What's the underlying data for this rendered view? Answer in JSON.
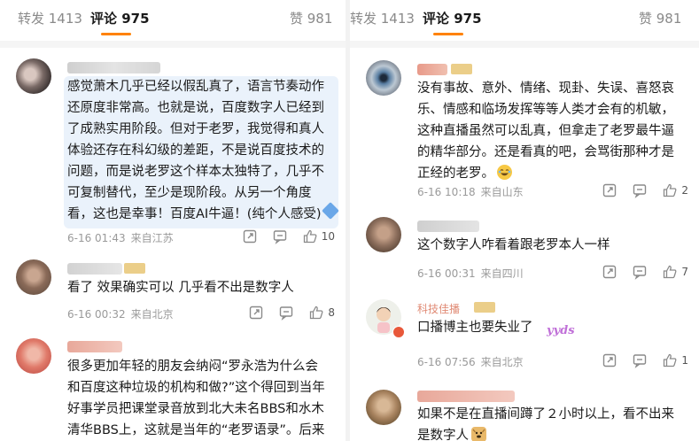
{
  "left": {
    "tabs": [
      {
        "label": "转发 1413"
      },
      {
        "label": "评论 975"
      },
      {
        "label": "赞 981"
      }
    ],
    "comments": [
      {
        "lines": [
          "感觉萧木几乎已经以假乱真了，语言节奏动作",
          "还原度非常高。也就是说，百度数字人已经到",
          "了成熟实用阶段。但对于老罗，我觉得和真人",
          "体验还存在科幻级的差距，不是说百度技术的",
          "问题，而是说老罗这个样本太独特了，几乎不",
          "可复制替代，至少是现阶段。从另一个角度",
          "看，这也是幸事！百度AI牛逼！(纯个人感受)"
        ],
        "date": "6-16 01:43",
        "source": "来自江苏",
        "likes": "10"
      },
      {
        "lines": [
          "看了 效果确实可以 几乎看不出是数字人"
        ],
        "date": "6-16 00:32",
        "source": "来自北京",
        "likes": "8"
      },
      {
        "lines": [
          "很多更加年轻的朋友会纳闷“罗永浩为什么会",
          "和百度这种垃圾的机构和做?”这个得回到当年",
          "好事学员把课堂录音放到北大未名BBS和水木",
          "清华BBS上，这就是当年的“老罗语录”。后来"
        ]
      }
    ]
  },
  "right": {
    "tabs": [
      {
        "label": "转发 1413"
      },
      {
        "label": "评论 975"
      },
      {
        "label": "赞 981"
      }
    ],
    "comments": [
      {
        "lines": [
          "没有事故、意外、情绪、现卦、失误、喜怒哀",
          "乐、情感和临场发挥等等人类才会有的机敏，",
          "这种直播虽然可以乱真，但拿走了老罗最牛逼",
          "的精华部分。还是看真的吧，会骂街那种才是",
          "正经的老罗。"
        ],
        "date": "6-16 10:18",
        "source": "来自山东",
        "likes": "2"
      },
      {
        "lines": [
          "这个数字人咋看着跟老罗本人一样"
        ],
        "date": "6-16 00:31",
        "source": "来自四川",
        "likes": "7"
      },
      {
        "name_visible": "科技佳播",
        "lines": [
          "口播博主也要失业了"
        ],
        "sticker": "yyds",
        "date": "6-16 07:56",
        "source": "来自北京",
        "likes": "1"
      },
      {
        "lines": [
          "如果不是在直播间蹲了２小时以上，看不出来",
          "是数字人"
        ]
      }
    ]
  },
  "icons": {
    "share": "share-icon",
    "comment": "comment-icon",
    "like": "thumbs-up-icon",
    "emoji_laugh": "laughing-emoji-icon",
    "emoji_doge": "doge-emoji-icon"
  },
  "colors": {
    "accent": "#ff8200",
    "highlight_bg": "#eaf2fb",
    "muted_text": "#9a9a9a"
  }
}
